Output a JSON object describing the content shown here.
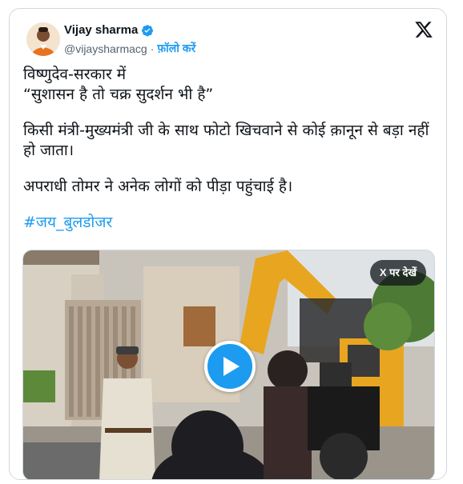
{
  "author": {
    "display_name": "Vijay sharma",
    "handle": "@vijaysharmacg",
    "separator": "·",
    "follow_label": "फ़ॉलो करें",
    "verified_icon": "verified-badge-icon",
    "verified_color": "#1d9bf0"
  },
  "tweet": {
    "line1": "विष्णुदेव-सरकार में",
    "line2": "“सुशासन है तो चक्र सुदर्शन भी है”",
    "para2": "किसी मंत्री-मुख्यमंत्री जी के साथ फोटो खिचवाने से कोई क़ानून से बड़ा नहीं हो जाता।",
    "para3": "अपराधी तोमर ने अनेक लोगों को पीड़ा पहुंचाई है।",
    "hashtag": "#जय_बुलडोजर"
  },
  "media": {
    "watch_label": "X पर देखें",
    "play_icon": "play-icon"
  },
  "colors": {
    "accent": "#1d9bf0",
    "text": "#0f1419",
    "secondary": "#536471"
  }
}
